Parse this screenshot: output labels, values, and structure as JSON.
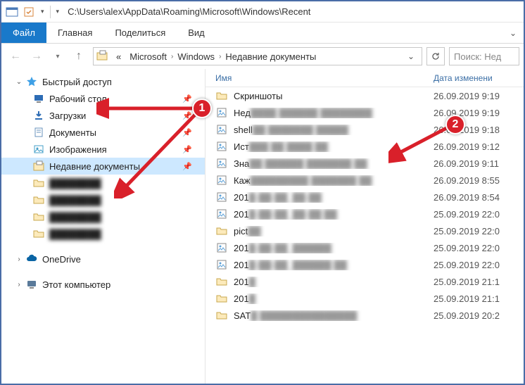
{
  "titlebar": {
    "path": "C:\\Users\\alex\\AppData\\Roaming\\Microsoft\\Windows\\Recent"
  },
  "ribbon": {
    "file": "Файл",
    "home": "Главная",
    "share": "Поделиться",
    "view": "Вид"
  },
  "breadcrumb": {
    "prefix": "«",
    "items": [
      "Microsoft",
      "Windows",
      "Недавние документы"
    ],
    "dropdown": "⌄"
  },
  "search": {
    "placeholder": "Поиск: Нед"
  },
  "sidebar": {
    "quick_access": "Быстрый доступ",
    "items": [
      {
        "label": "Рабочий стол",
        "icon": "desktop",
        "pinned": true
      },
      {
        "label": "Загрузки",
        "icon": "downloads",
        "pinned": true
      },
      {
        "label": "Документы",
        "icon": "documents",
        "pinned": true
      },
      {
        "label": "Изображения",
        "icon": "pictures",
        "pinned": true
      },
      {
        "label": "Недавние документы",
        "icon": "recent",
        "pinned": true,
        "selected": true
      },
      {
        "label": "blur1",
        "icon": "folder",
        "blurred": true
      },
      {
        "label": "blur2",
        "icon": "folder",
        "blurred": true
      },
      {
        "label": "blur3",
        "icon": "folder",
        "blurred": true
      },
      {
        "label": "blur4",
        "icon": "folder",
        "blurred": true
      }
    ],
    "onedrive": "OneDrive",
    "thispc": "Этот компьютер"
  },
  "columns": {
    "name": "Имя",
    "date": "Дата изменени"
  },
  "files": [
    {
      "icon": "folder",
      "name": "Скриншоты",
      "blur": "",
      "date": "26.09.2019 9:19"
    },
    {
      "icon": "img",
      "name": "Нед",
      "blur": "████ ██████ ████████",
      "date": "26.09.2019 9:19"
    },
    {
      "icon": "img",
      "name": "shell",
      "blur": "██ ███████ █████",
      "date": "26.09.2019 9:18"
    },
    {
      "icon": "img",
      "name": "Ист",
      "blur": "███ ██ ████ ██",
      "date": "26.09.2019 9:12"
    },
    {
      "icon": "img",
      "name": "Зна",
      "blur": "██ ██████ ███████ ██",
      "date": "26.09.2019 9:11"
    },
    {
      "icon": "img",
      "name": "Каж",
      "blur": "█████████ ███████ ██",
      "date": "26.09.2019 8:55"
    },
    {
      "icon": "img",
      "name": "201",
      "blur": "█-██-██_██-██",
      "date": "26.09.2019 8:54"
    },
    {
      "icon": "img",
      "name": "201",
      "blur": "█-██-██_██-██ ██",
      "date": "25.09.2019 22:0"
    },
    {
      "icon": "folder",
      "name": "pict",
      "blur": "██",
      "date": "25.09.2019 22:0"
    },
    {
      "icon": "img",
      "name": "201",
      "blur": "█-██-██_██████",
      "date": "25.09.2019 22:0"
    },
    {
      "icon": "img",
      "name": "201",
      "blur": "█-██-██_██████ ██",
      "date": "25.09.2019 22:0"
    },
    {
      "icon": "folder",
      "name": "201",
      "blur": "█",
      "date": "25.09.2019 21:1"
    },
    {
      "icon": "folder",
      "name": "201",
      "blur": "█",
      "date": "25.09.2019 21:1"
    },
    {
      "icon": "folder",
      "name": "SAT",
      "blur": "█ ███████████████",
      "date": "25.09.2019 20:2"
    }
  ],
  "markers": {
    "m1": "1",
    "m2": "2"
  }
}
